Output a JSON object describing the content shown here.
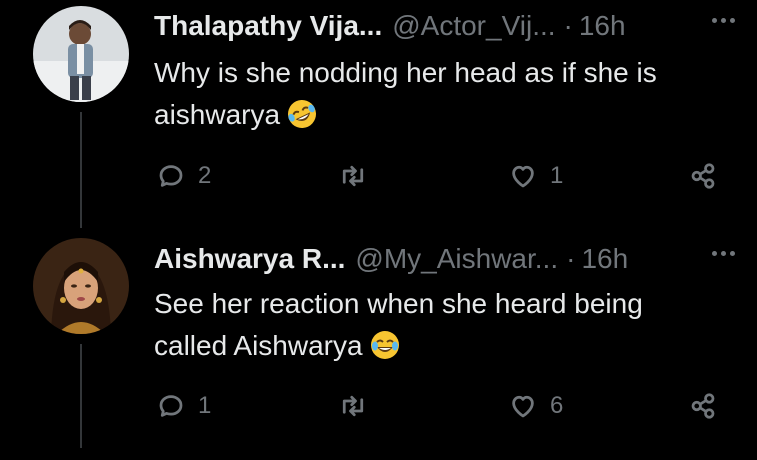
{
  "tweets": [
    {
      "name": "Thalapathy Vija...",
      "handle": "@Actor_Vij...",
      "dot": "·",
      "time": "16h",
      "text": "Why is she nodding her head as if she is aishwarya",
      "emoji": "rolling-on-floor-laughing",
      "reply_count": "2",
      "retweet_count": "",
      "like_count": "1"
    },
    {
      "name": "Aishwarya R...",
      "handle": "@My_Aishwar...",
      "dot": "·",
      "time": "16h",
      "text": "See her reaction when she heard being called Aishwarya",
      "emoji": "face-with-tears-of-joy",
      "reply_count": "1",
      "retweet_count": "",
      "like_count": "6"
    }
  ],
  "colors": {
    "background": "#000000",
    "primary_text": "#e7e9ea",
    "secondary_text": "#71767b",
    "thread_line": "#333639"
  }
}
